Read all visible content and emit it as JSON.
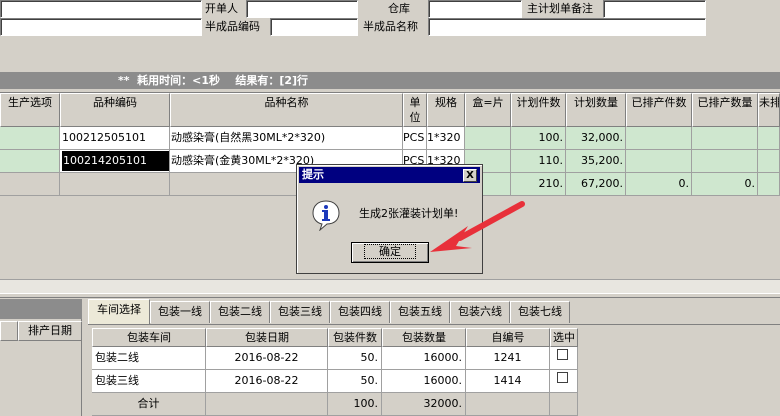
{
  "form": {
    "creator_label": "开单人",
    "warehouse_label": "仓库",
    "master_plan_note_label": "主计划单备注",
    "semi_code_label": "半成品编码",
    "semi_name_label": "半成品名称"
  },
  "status": {
    "text": "**  耗用时间：<1秒    结果有：[2]行"
  },
  "top_grid": {
    "headers": [
      "生产选项",
      "品种编码",
      "品种名称",
      "单位",
      "规格",
      "盒=片",
      "计划件数",
      "计划数量",
      "已排产件数",
      "已排产数量",
      "未排"
    ],
    "rows": [
      {
        "code": "100212505101",
        "name": "动感染膏(自然黑30ML*2*320)",
        "unit": "PCS",
        "spec": "1*320",
        "pieces": "100.",
        "qty": "32,000.",
        "done_pieces": "",
        "done_qty": ""
      },
      {
        "code": "100214205101",
        "name": "动感染膏(金黄30ML*2*320)",
        "unit": "PCS",
        "spec": "1*320",
        "pieces": "110.",
        "qty": "35,200.",
        "done_pieces": "",
        "done_qty": ""
      },
      {
        "code": "",
        "name": "",
        "unit": "",
        "spec": "",
        "pieces": "210.",
        "qty": "67,200.",
        "done_pieces": "0.",
        "done_qty": "0."
      }
    ]
  },
  "left_panel": {
    "header": "排产日期"
  },
  "tabs": [
    "车间选择",
    "包装一线",
    "包装二线",
    "包装三线",
    "包装四线",
    "包装五线",
    "包装六线",
    "包装七线"
  ],
  "bottom_grid": {
    "headers": [
      "包装车间",
      "包装日期",
      "包装件数",
      "包装数量",
      "自编号",
      "选中"
    ],
    "rows": [
      {
        "workshop": "包装二线",
        "date": "2016-08-22",
        "pieces": "50.",
        "qty": "16000.",
        "code": "1241"
      },
      {
        "workshop": "包装三线",
        "date": "2016-08-22",
        "pieces": "50.",
        "qty": "16000.",
        "code": "1414"
      }
    ],
    "total": {
      "label": "合计",
      "pieces": "100.",
      "qty": "32000."
    }
  },
  "dialog": {
    "title": "提示",
    "close": "X",
    "message": "生成2张灌装计划单!",
    "ok": "确定",
    "icon": "info-icon"
  },
  "colors": {
    "row_green": "#cfe7cf",
    "title_bar": "#000080",
    "arrow": "#e8303a"
  }
}
